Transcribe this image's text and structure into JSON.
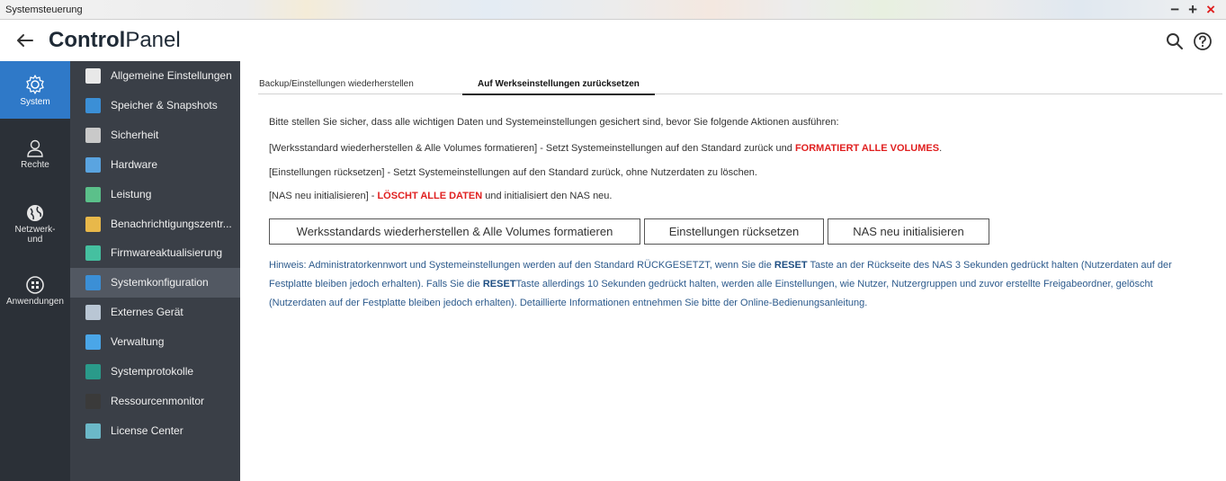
{
  "window": {
    "title": "Systemsteuerung",
    "controls": {
      "minimize": "−",
      "maximize": "+",
      "close": "×"
    }
  },
  "header": {
    "title_bold": "Control",
    "title_rest": "Panel",
    "icons": [
      "back-arrow-icon",
      "search-icon",
      "help-icon"
    ]
  },
  "rail": {
    "items": [
      {
        "label": "System",
        "icon": "gear-icon",
        "active": true
      },
      {
        "label": "Rechte",
        "icon": "user-icon",
        "active": false
      },
      {
        "label": "Netzwerk-\nund",
        "icon": "globe-icon",
        "active": false
      },
      {
        "label": "Anwendungen",
        "icon": "apps-icon",
        "active": false
      }
    ]
  },
  "sidebar": {
    "items": [
      {
        "label": "Allgemeine Einstellungen",
        "icon": "clipboard-icon",
        "color": "#e8e8e8"
      },
      {
        "label": "Speicher & Snapshots",
        "icon": "storage-icon",
        "color": "#3b8fd6"
      },
      {
        "label": "Sicherheit",
        "icon": "lock-icon",
        "color": "#c9c9c9"
      },
      {
        "label": "Hardware",
        "icon": "hardware-icon",
        "color": "#5aa4e0"
      },
      {
        "label": "Leistung",
        "icon": "bulb-icon",
        "color": "#5bc08a"
      },
      {
        "label": "Benachrichtigungszentr...",
        "icon": "notification-icon",
        "color": "#e8b84a"
      },
      {
        "label": "Firmwareaktualisierung",
        "icon": "firmware-icon",
        "color": "#45c0a0"
      },
      {
        "label": "Systemkonfiguration",
        "icon": "sysconfig-icon",
        "color": "#3b8fd6",
        "active": true
      },
      {
        "label": "Externes Gerät",
        "icon": "external-device-icon",
        "color": "#b9c6d4"
      },
      {
        "label": "Verwaltung",
        "icon": "monitor-icon",
        "color": "#4aa6e8"
      },
      {
        "label": "Systemprotokolle",
        "icon": "log-icon",
        "color": "#2a9a8a"
      },
      {
        "label": "Ressourcenmonitor",
        "icon": "resource-monitor-icon",
        "color": "#3a3a3a"
      },
      {
        "label": "License Center",
        "icon": "license-icon",
        "color": "#6bb8c8"
      }
    ]
  },
  "tabs": [
    {
      "label": "Backup/Einstellungen wiederherstellen",
      "active": false
    },
    {
      "label": "Auf Werkseinstellungen zurücksetzen",
      "active": true
    }
  ],
  "content": {
    "intro": "Bitte stellen Sie sicher, dass alle wichtigen Daten und Systemeinstellungen gesichert sind, bevor Sie folgende Aktionen ausführen:",
    "line1_a": "[Werksstandard wiederherstellen & Alle Volumes formatieren] - Setzt Systemeinstellungen auf den Standard zurück und ",
    "line1_b": "FORMATIERT ALLE VOLUMES",
    "line1_c": ".",
    "line2": "[Einstellungen rücksetzen] - Setzt Systemeinstellungen auf den Standard zurück, ohne Nutzerdaten zu löschen.",
    "line3_a": "[NAS neu initialisieren] - ",
    "line3_b": "LÖSCHT ALLE DATEN",
    "line3_c": " und initialisiert den NAS neu.",
    "buttons": {
      "factory_format": "Werksstandards wiederherstellen & Alle Volumes formatieren",
      "reset_settings": "Einstellungen rücksetzen",
      "reinit_nas": "NAS neu initialisieren"
    },
    "note": {
      "p1": "Hinweis: Administratorkennwort und Systemeinstellungen werden auf den Standard RÜCKGESETZT, wenn Sie die ",
      "reset1": "RESET",
      "p2": " Taste an der Rückseite des NAS 3 Sekunden gedrückt halten (Nutzerdaten auf der Festplatte bleiben jedoch erhalten). Falls Sie die ",
      "reset2": "RESET",
      "p3": "Taste allerdings 10 Sekunden gedrückt halten, werden alle Einstellungen, wie Nutzer, Nutzergruppen und zuvor erstellte Freigabeordner, gelöscht (Nutzerdaten auf der Festplatte bleiben jedoch erhalten). Detaillierte Informationen entnehmen Sie bitte der Online-Bedienungsanleitung."
    }
  }
}
